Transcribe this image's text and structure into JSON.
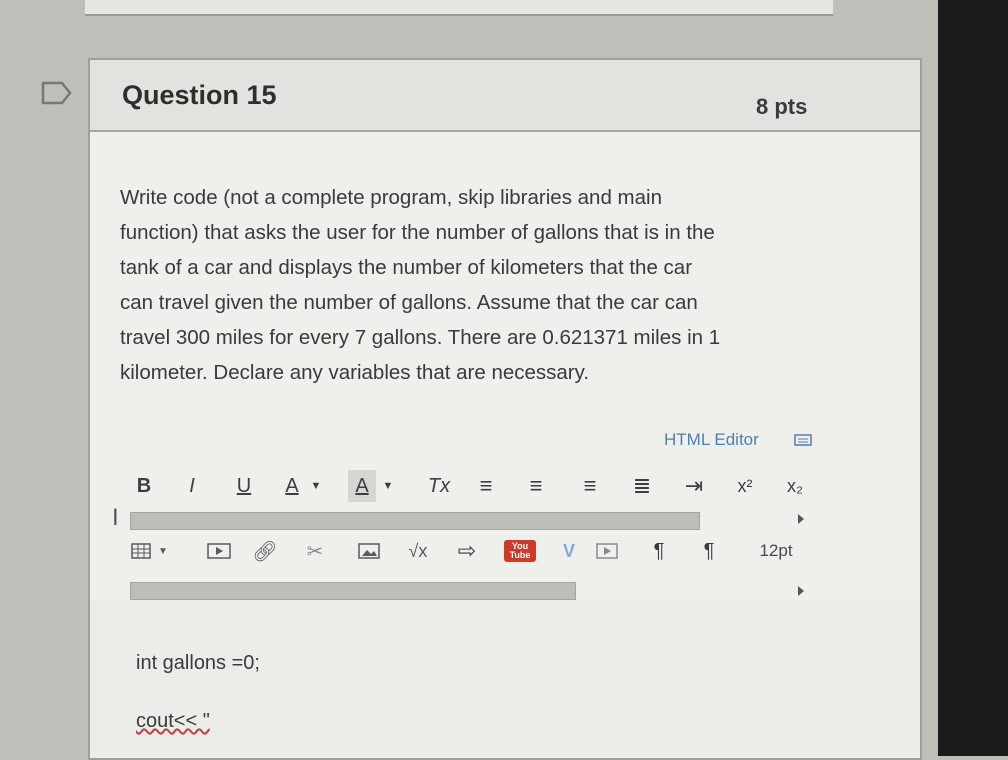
{
  "question": {
    "title": "Question 15",
    "points": "8 pts",
    "lines": [
      "Write code (not a complete program, skip libraries and main",
      "function) that asks the user for the number of gallons that is in the",
      "tank of a car and displays the number of kilometers that the car",
      "can travel given the number of gallons.  Assume that the car can",
      "travel 300 miles for every 7 gallons. There are 0.621371 miles in 1",
      "kilometer. Declare any variables that are necessary."
    ]
  },
  "editor": {
    "html_editor_label": "HTML Editor",
    "toolbar1": [
      "B",
      "I",
      "U",
      "A",
      "A",
      "Tx",
      "align-left",
      "align-center",
      "align-right",
      "justify",
      "indent",
      "x²",
      "x₂"
    ],
    "font_size": "12pt",
    "youtube_label": "You Tube",
    "content_lines": [
      "int gallons =0;",
      "cout<< \""
    ]
  },
  "colors": {
    "link": "#4f7fb3",
    "youtube": "#cc3b2a",
    "bg": "#efefeb"
  },
  "icons": [
    "flag-icon",
    "keyboard-icon",
    "table-icon",
    "media-icon",
    "link-icon",
    "unlink-icon",
    "image-icon",
    "equation-icon",
    "embed-icon",
    "youtube-icon",
    "vimeo-icon",
    "video-icon",
    "ltr-icon",
    "rtl-icon"
  ]
}
